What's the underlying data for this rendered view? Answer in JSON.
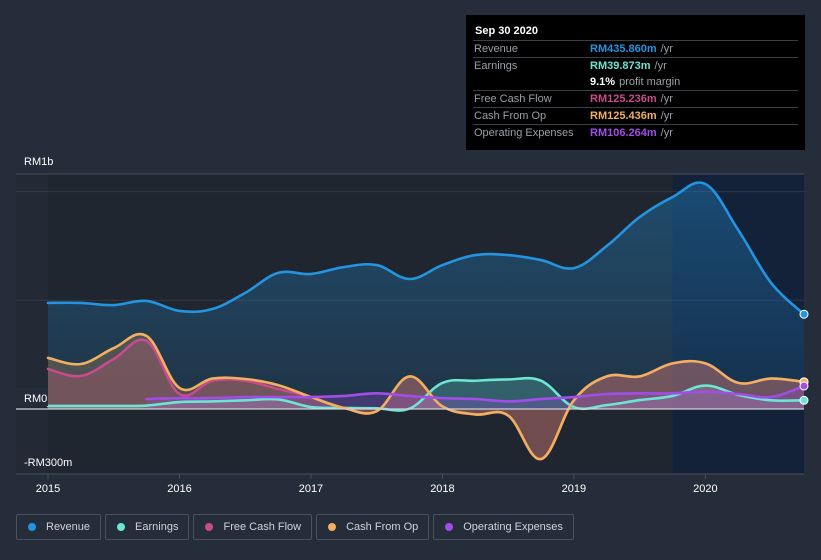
{
  "tooltip": {
    "date": "Sep 30 2020",
    "rows": [
      {
        "label": "Revenue",
        "value": "RM435.860m",
        "unit": "/yr",
        "color": "#2394df"
      },
      {
        "label": "Earnings",
        "value": "RM39.873m",
        "unit": "/yr",
        "color": "#6ce5d4"
      },
      {
        "label": "",
        "value": "9.1%",
        "unit": "profit margin",
        "color": "#ffffff"
      },
      {
        "label": "Free Cash Flow",
        "value": "RM125.236m",
        "unit": "/yr",
        "color": "#c84b8c"
      },
      {
        "label": "Cash From Op",
        "value": "RM125.436m",
        "unit": "/yr",
        "color": "#f0b05f"
      },
      {
        "label": "Operating Expenses",
        "value": "RM106.264m",
        "unit": "/yr",
        "color": "#a24de8"
      }
    ]
  },
  "legend": [
    {
      "label": "Revenue",
      "color": "#2394df"
    },
    {
      "label": "Earnings",
      "color": "#6ce5d4"
    },
    {
      "label": "Free Cash Flow",
      "color": "#c84b8c"
    },
    {
      "label": "Cash From Op",
      "color": "#f0b05f"
    },
    {
      "label": "Operating Expenses",
      "color": "#a24de8"
    }
  ],
  "chart_data": {
    "type": "area",
    "title": "",
    "xlabel": "",
    "ylabel": "",
    "currency": "RM",
    "y_tick_labels": [
      "RM1b",
      "RM0",
      "-RM300m"
    ],
    "y_ticks": [
      1000,
      0,
      -300
    ],
    "ylim": [
      -300,
      1085
    ],
    "xlim": [
      2015.0,
      2020.75
    ],
    "x_tick_labels": [
      "2015",
      "2016",
      "2017",
      "2018",
      "2019",
      "2020"
    ],
    "x_ticks": [
      2015,
      2016,
      2017,
      2018,
      2019,
      2020
    ],
    "grid": true,
    "highlight_start": 2019.75,
    "legend_position": "bottom-left",
    "x": [
      2015.0,
      2015.25,
      2015.5,
      2015.75,
      2016.0,
      2016.25,
      2016.5,
      2016.75,
      2017.0,
      2017.25,
      2017.5,
      2017.75,
      2018.0,
      2018.25,
      2018.5,
      2018.75,
      2019.0,
      2019.25,
      2019.5,
      2019.75,
      2020.0,
      2020.25,
      2020.5,
      2020.75
    ],
    "series": [
      {
        "name": "Revenue",
        "color": "#2394df",
        "values": [
          488,
          488,
          478,
          497,
          451,
          460,
          534,
          626,
          621,
          653,
          662,
          598,
          662,
          708,
          708,
          685,
          648,
          750,
          883,
          975,
          1035,
          823,
          580,
          436
        ]
      },
      {
        "name": "Earnings",
        "color": "#6ce5d4",
        "values": [
          14,
          14,
          14,
          16,
          32,
          35,
          40,
          44,
          9,
          5,
          3,
          2,
          120,
          130,
          136,
          130,
          9,
          18,
          41,
          60,
          108,
          65,
          40,
          40
        ]
      },
      {
        "name": "Free Cash Flow",
        "color": "#c84b8c",
        "values": [
          184,
          152,
          230,
          313,
          69,
          130,
          130,
          92,
          55,
          5,
          -10,
          150,
          12,
          -25,
          -30,
          -230,
          40,
          150,
          150,
          210,
          210,
          120,
          140,
          125
        ]
      },
      {
        "name": "Cash From Op",
        "color": "#f0b05f",
        "values": [
          235,
          207,
          280,
          336,
          97,
          140,
          138,
          110,
          55,
          5,
          -10,
          150,
          12,
          -25,
          -30,
          -230,
          40,
          150,
          150,
          210,
          210,
          120,
          140,
          125
        ]
      },
      {
        "name": "Operating Expenses",
        "color": "#a24de8",
        "values": [
          null,
          null,
          null,
          46,
          50,
          50,
          55,
          55,
          55,
          60,
          72,
          60,
          50,
          46,
          35,
          46,
          55,
          69,
          72,
          72,
          80,
          69,
          55,
          106
        ]
      }
    ]
  }
}
